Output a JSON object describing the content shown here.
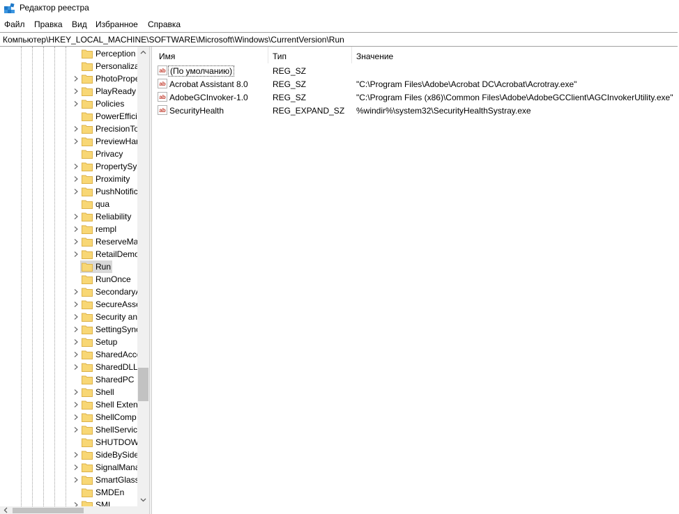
{
  "window": {
    "title": "Редактор реестра"
  },
  "menu": [
    "Файл",
    "Правка",
    "Вид",
    "Избранное",
    "Справка"
  ],
  "address": "Компьютер\\HKEY_LOCAL_MACHINE\\SOFTWARE\\Microsoft\\Windows\\CurrentVersion\\Run",
  "tree": {
    "items": [
      {
        "label": "Perception",
        "expandable": false
      },
      {
        "label": "Personaliza",
        "expandable": false
      },
      {
        "label": "PhotoPrope",
        "expandable": true
      },
      {
        "label": "PlayReady",
        "expandable": true
      },
      {
        "label": "Policies",
        "expandable": true
      },
      {
        "label": "PowerEffici",
        "expandable": false
      },
      {
        "label": "PrecisionTo",
        "expandable": true
      },
      {
        "label": "PreviewHar",
        "expandable": true
      },
      {
        "label": "Privacy",
        "expandable": false
      },
      {
        "label": "PropertySys",
        "expandable": true
      },
      {
        "label": "Proximity",
        "expandable": true
      },
      {
        "label": "PushNotific",
        "expandable": true
      },
      {
        "label": "qua",
        "expandable": false
      },
      {
        "label": "Reliability",
        "expandable": true
      },
      {
        "label": "rempl",
        "expandable": true
      },
      {
        "label": "ReserveMar",
        "expandable": true
      },
      {
        "label": "RetailDemo",
        "expandable": true
      },
      {
        "label": "Run",
        "expandable": false,
        "selected": true
      },
      {
        "label": "RunOnce",
        "expandable": false
      },
      {
        "label": "SecondaryA",
        "expandable": true
      },
      {
        "label": "SecureAsse",
        "expandable": true
      },
      {
        "label": "Security an",
        "expandable": true
      },
      {
        "label": "SettingSync",
        "expandable": true
      },
      {
        "label": "Setup",
        "expandable": true
      },
      {
        "label": "SharedAcce",
        "expandable": true
      },
      {
        "label": "SharedDLLs",
        "expandable": true
      },
      {
        "label": "SharedPC",
        "expandable": false
      },
      {
        "label": "Shell",
        "expandable": true
      },
      {
        "label": "Shell Extens",
        "expandable": true
      },
      {
        "label": "ShellComp",
        "expandable": true
      },
      {
        "label": "ShellService",
        "expandable": true
      },
      {
        "label": "SHUTDOWN",
        "expandable": false
      },
      {
        "label": "SideBySide",
        "expandable": true
      },
      {
        "label": "SignalMana",
        "expandable": true
      },
      {
        "label": "SmartGlass",
        "expandable": true
      },
      {
        "label": "SMDEn",
        "expandable": false
      },
      {
        "label": "SML",
        "expandable": true
      }
    ]
  },
  "list": {
    "columns": [
      "Имя",
      "Тип",
      "Значение"
    ],
    "rows": [
      {
        "name": "(По умолчанию)",
        "type": "REG_SZ",
        "data": ""
      },
      {
        "name": "Acrobat Assistant 8.0",
        "type": "REG_SZ",
        "data": "\"C:\\Program Files\\Adobe\\Acrobat DC\\Acrobat\\Acrotray.exe\""
      },
      {
        "name": "AdobeGCInvoker-1.0",
        "type": "REG_SZ",
        "data": "\"C:\\Program Files (x86)\\Common Files\\Adobe\\AdobeGCClient\\AGCInvokerUtility.exe\""
      },
      {
        "name": "SecurityHealth",
        "type": "REG_EXPAND_SZ",
        "data": "%windir%\\system32\\SecurityHealthSystray.exe"
      }
    ]
  },
  "colors": {
    "folder": "#f8d775",
    "folder_edge": "#dcb24a",
    "ab_icon": "#c0392b",
    "selection": "#d9d9d9"
  }
}
